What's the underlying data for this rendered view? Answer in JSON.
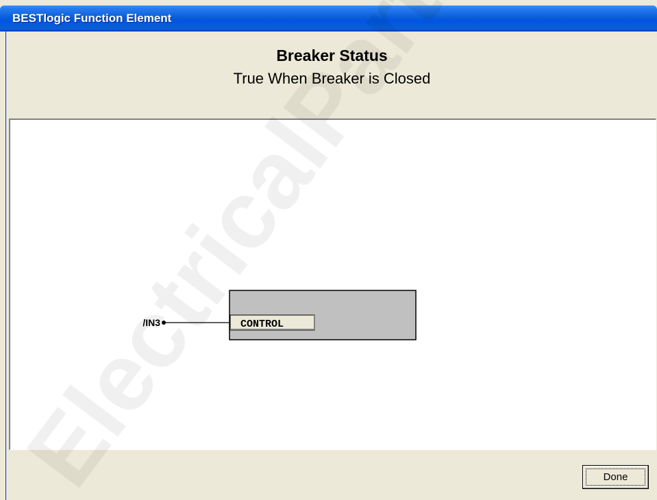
{
  "window": {
    "title": "BESTlogic Function Element"
  },
  "header": {
    "title": "Breaker Status",
    "subtitle": "True When Breaker is Closed"
  },
  "diagram": {
    "input_label": "/IN3",
    "block_label": "CONTROL"
  },
  "buttons": {
    "done_label": "Done"
  },
  "watermark": {
    "text": "ElectricalPartManuals"
  }
}
